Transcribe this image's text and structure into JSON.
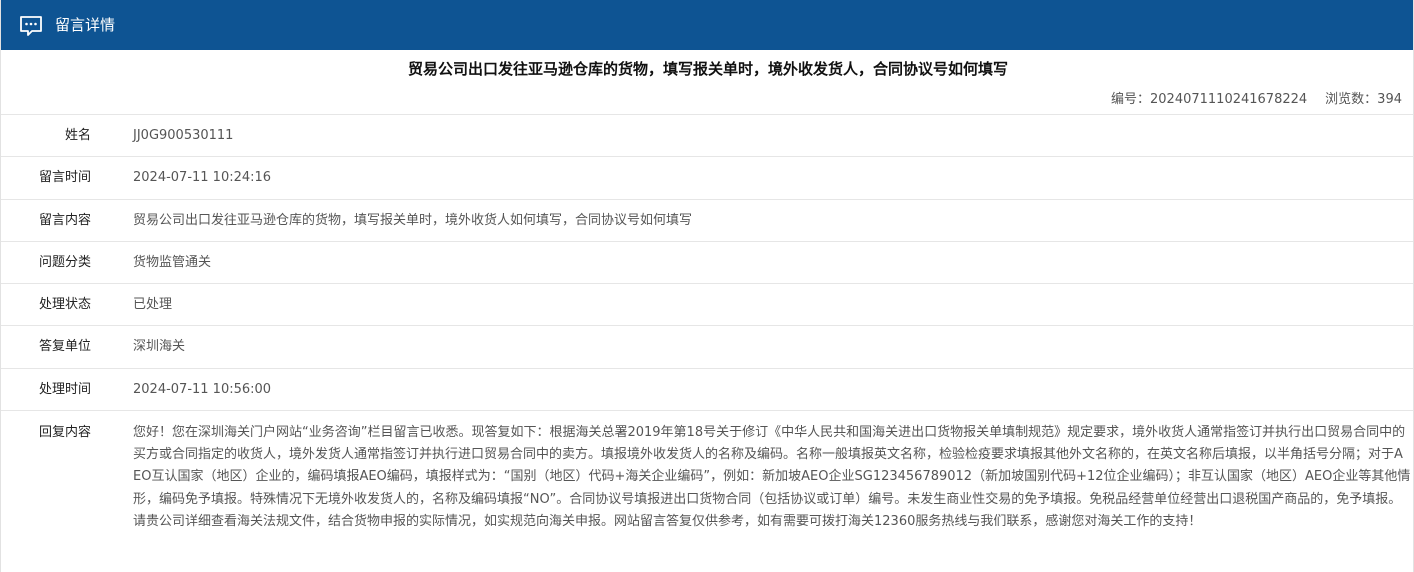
{
  "header": {
    "icon": "message-icon",
    "title": "留言详情",
    "bg_color": "#0e5493"
  },
  "message": {
    "title": "贸易公司出口发往亚马逊仓库的货物，填写报关单时，境外收发货人，合同协议号如何填写",
    "serial_label": "编号：",
    "serial_value": "2024071110241678224",
    "views_label": "浏览数：",
    "views_value": "394"
  },
  "fields": [
    {
      "label": "姓名",
      "value": "JJ0G900530111"
    },
    {
      "label": "留言时间",
      "value": "2024-07-11 10:24:16"
    },
    {
      "label": "留言内容",
      "value": "贸易公司出口发往亚马逊仓库的货物，填写报关单时，境外收货人如何填写，合同协议号如何填写"
    },
    {
      "label": "问题分类",
      "value": "货物监管通关"
    },
    {
      "label": "处理状态",
      "value": "已处理"
    },
    {
      "label": "答复单位",
      "value": "深圳海关"
    },
    {
      "label": "处理时间",
      "value": "2024-07-11 10:56:00"
    },
    {
      "label": "回复内容",
      "value": "您好！您在深圳海关门户网站“业务咨询”栏目留言已收悉。现答复如下：根据海关总署2019年第18号关于修订《中华人民共和国海关进出口货物报关单填制规范》规定要求，境外收货人通常指签订并执行出口贸易合同中的买方或合同指定的收货人，境外发货人通常指签订并执行进口贸易合同中的卖方。填报境外收发货人的名称及编码。名称一般填报英文名称，检验检疫要求填报其他外文名称的，在英文名称后填报，以半角括号分隔；对于AEO互认国家（地区）企业的，编码填报AEO编码，填报样式为：“国别（地区）代码+海关企业编码”，例如：新加坡AEO企业SG123456789012（新加坡国别代码+12位企业编码）；非互认国家（地区）AEO企业等其他情形，编码免予填报。特殊情况下无境外收发货人的，名称及编码填报“NO”。合同协议号填报进出口货物合同（包括协议或订单）编号。未发生商业性交易的免予填报。免税品经营单位经营出口退税国产商品的，免予填报。请贵公司详细查看海关法规文件，结合货物申报的实际情况，如实规范向海关申报。网站留言答复仅供参考，如有需要可拨打海关12360服务热线与我们联系，感谢您对海关工作的支持！"
    }
  ]
}
